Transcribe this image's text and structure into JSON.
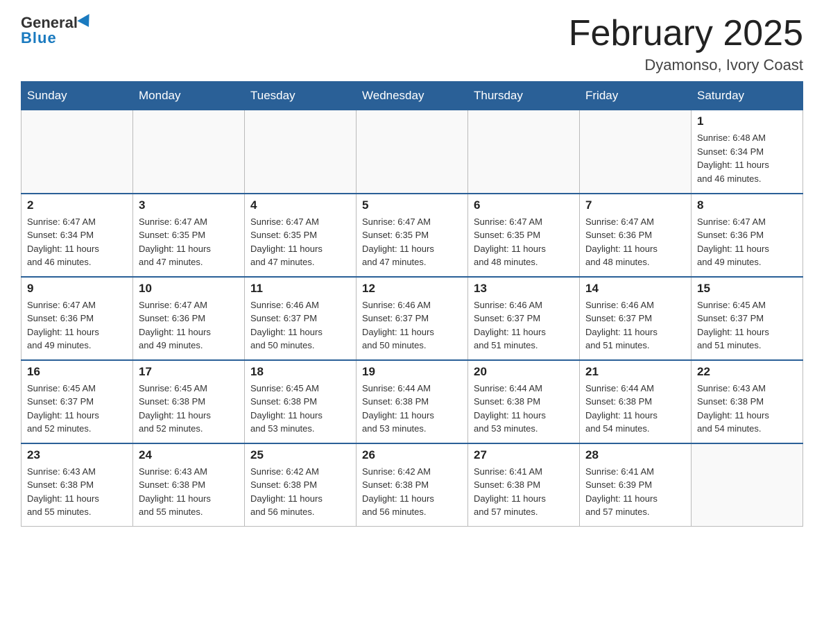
{
  "header": {
    "logo_general": "General",
    "logo_blue": "Blue",
    "month_title": "February 2025",
    "location": "Dyamonso, Ivory Coast"
  },
  "weekdays": [
    "Sunday",
    "Monday",
    "Tuesday",
    "Wednesday",
    "Thursday",
    "Friday",
    "Saturday"
  ],
  "weeks": [
    [
      {
        "day": "",
        "info": ""
      },
      {
        "day": "",
        "info": ""
      },
      {
        "day": "",
        "info": ""
      },
      {
        "day": "",
        "info": ""
      },
      {
        "day": "",
        "info": ""
      },
      {
        "day": "",
        "info": ""
      },
      {
        "day": "1",
        "info": "Sunrise: 6:48 AM\nSunset: 6:34 PM\nDaylight: 11 hours\nand 46 minutes."
      }
    ],
    [
      {
        "day": "2",
        "info": "Sunrise: 6:47 AM\nSunset: 6:34 PM\nDaylight: 11 hours\nand 46 minutes."
      },
      {
        "day": "3",
        "info": "Sunrise: 6:47 AM\nSunset: 6:35 PM\nDaylight: 11 hours\nand 47 minutes."
      },
      {
        "day": "4",
        "info": "Sunrise: 6:47 AM\nSunset: 6:35 PM\nDaylight: 11 hours\nand 47 minutes."
      },
      {
        "day": "5",
        "info": "Sunrise: 6:47 AM\nSunset: 6:35 PM\nDaylight: 11 hours\nand 47 minutes."
      },
      {
        "day": "6",
        "info": "Sunrise: 6:47 AM\nSunset: 6:35 PM\nDaylight: 11 hours\nand 48 minutes."
      },
      {
        "day": "7",
        "info": "Sunrise: 6:47 AM\nSunset: 6:36 PM\nDaylight: 11 hours\nand 48 minutes."
      },
      {
        "day": "8",
        "info": "Sunrise: 6:47 AM\nSunset: 6:36 PM\nDaylight: 11 hours\nand 49 minutes."
      }
    ],
    [
      {
        "day": "9",
        "info": "Sunrise: 6:47 AM\nSunset: 6:36 PM\nDaylight: 11 hours\nand 49 minutes."
      },
      {
        "day": "10",
        "info": "Sunrise: 6:47 AM\nSunset: 6:36 PM\nDaylight: 11 hours\nand 49 minutes."
      },
      {
        "day": "11",
        "info": "Sunrise: 6:46 AM\nSunset: 6:37 PM\nDaylight: 11 hours\nand 50 minutes."
      },
      {
        "day": "12",
        "info": "Sunrise: 6:46 AM\nSunset: 6:37 PM\nDaylight: 11 hours\nand 50 minutes."
      },
      {
        "day": "13",
        "info": "Sunrise: 6:46 AM\nSunset: 6:37 PM\nDaylight: 11 hours\nand 51 minutes."
      },
      {
        "day": "14",
        "info": "Sunrise: 6:46 AM\nSunset: 6:37 PM\nDaylight: 11 hours\nand 51 minutes."
      },
      {
        "day": "15",
        "info": "Sunrise: 6:45 AM\nSunset: 6:37 PM\nDaylight: 11 hours\nand 51 minutes."
      }
    ],
    [
      {
        "day": "16",
        "info": "Sunrise: 6:45 AM\nSunset: 6:37 PM\nDaylight: 11 hours\nand 52 minutes."
      },
      {
        "day": "17",
        "info": "Sunrise: 6:45 AM\nSunset: 6:38 PM\nDaylight: 11 hours\nand 52 minutes."
      },
      {
        "day": "18",
        "info": "Sunrise: 6:45 AM\nSunset: 6:38 PM\nDaylight: 11 hours\nand 53 minutes."
      },
      {
        "day": "19",
        "info": "Sunrise: 6:44 AM\nSunset: 6:38 PM\nDaylight: 11 hours\nand 53 minutes."
      },
      {
        "day": "20",
        "info": "Sunrise: 6:44 AM\nSunset: 6:38 PM\nDaylight: 11 hours\nand 53 minutes."
      },
      {
        "day": "21",
        "info": "Sunrise: 6:44 AM\nSunset: 6:38 PM\nDaylight: 11 hours\nand 54 minutes."
      },
      {
        "day": "22",
        "info": "Sunrise: 6:43 AM\nSunset: 6:38 PM\nDaylight: 11 hours\nand 54 minutes."
      }
    ],
    [
      {
        "day": "23",
        "info": "Sunrise: 6:43 AM\nSunset: 6:38 PM\nDaylight: 11 hours\nand 55 minutes."
      },
      {
        "day": "24",
        "info": "Sunrise: 6:43 AM\nSunset: 6:38 PM\nDaylight: 11 hours\nand 55 minutes."
      },
      {
        "day": "25",
        "info": "Sunrise: 6:42 AM\nSunset: 6:38 PM\nDaylight: 11 hours\nand 56 minutes."
      },
      {
        "day": "26",
        "info": "Sunrise: 6:42 AM\nSunset: 6:38 PM\nDaylight: 11 hours\nand 56 minutes."
      },
      {
        "day": "27",
        "info": "Sunrise: 6:41 AM\nSunset: 6:38 PM\nDaylight: 11 hours\nand 57 minutes."
      },
      {
        "day": "28",
        "info": "Sunrise: 6:41 AM\nSunset: 6:39 PM\nDaylight: 11 hours\nand 57 minutes."
      },
      {
        "day": "",
        "info": ""
      }
    ]
  ]
}
